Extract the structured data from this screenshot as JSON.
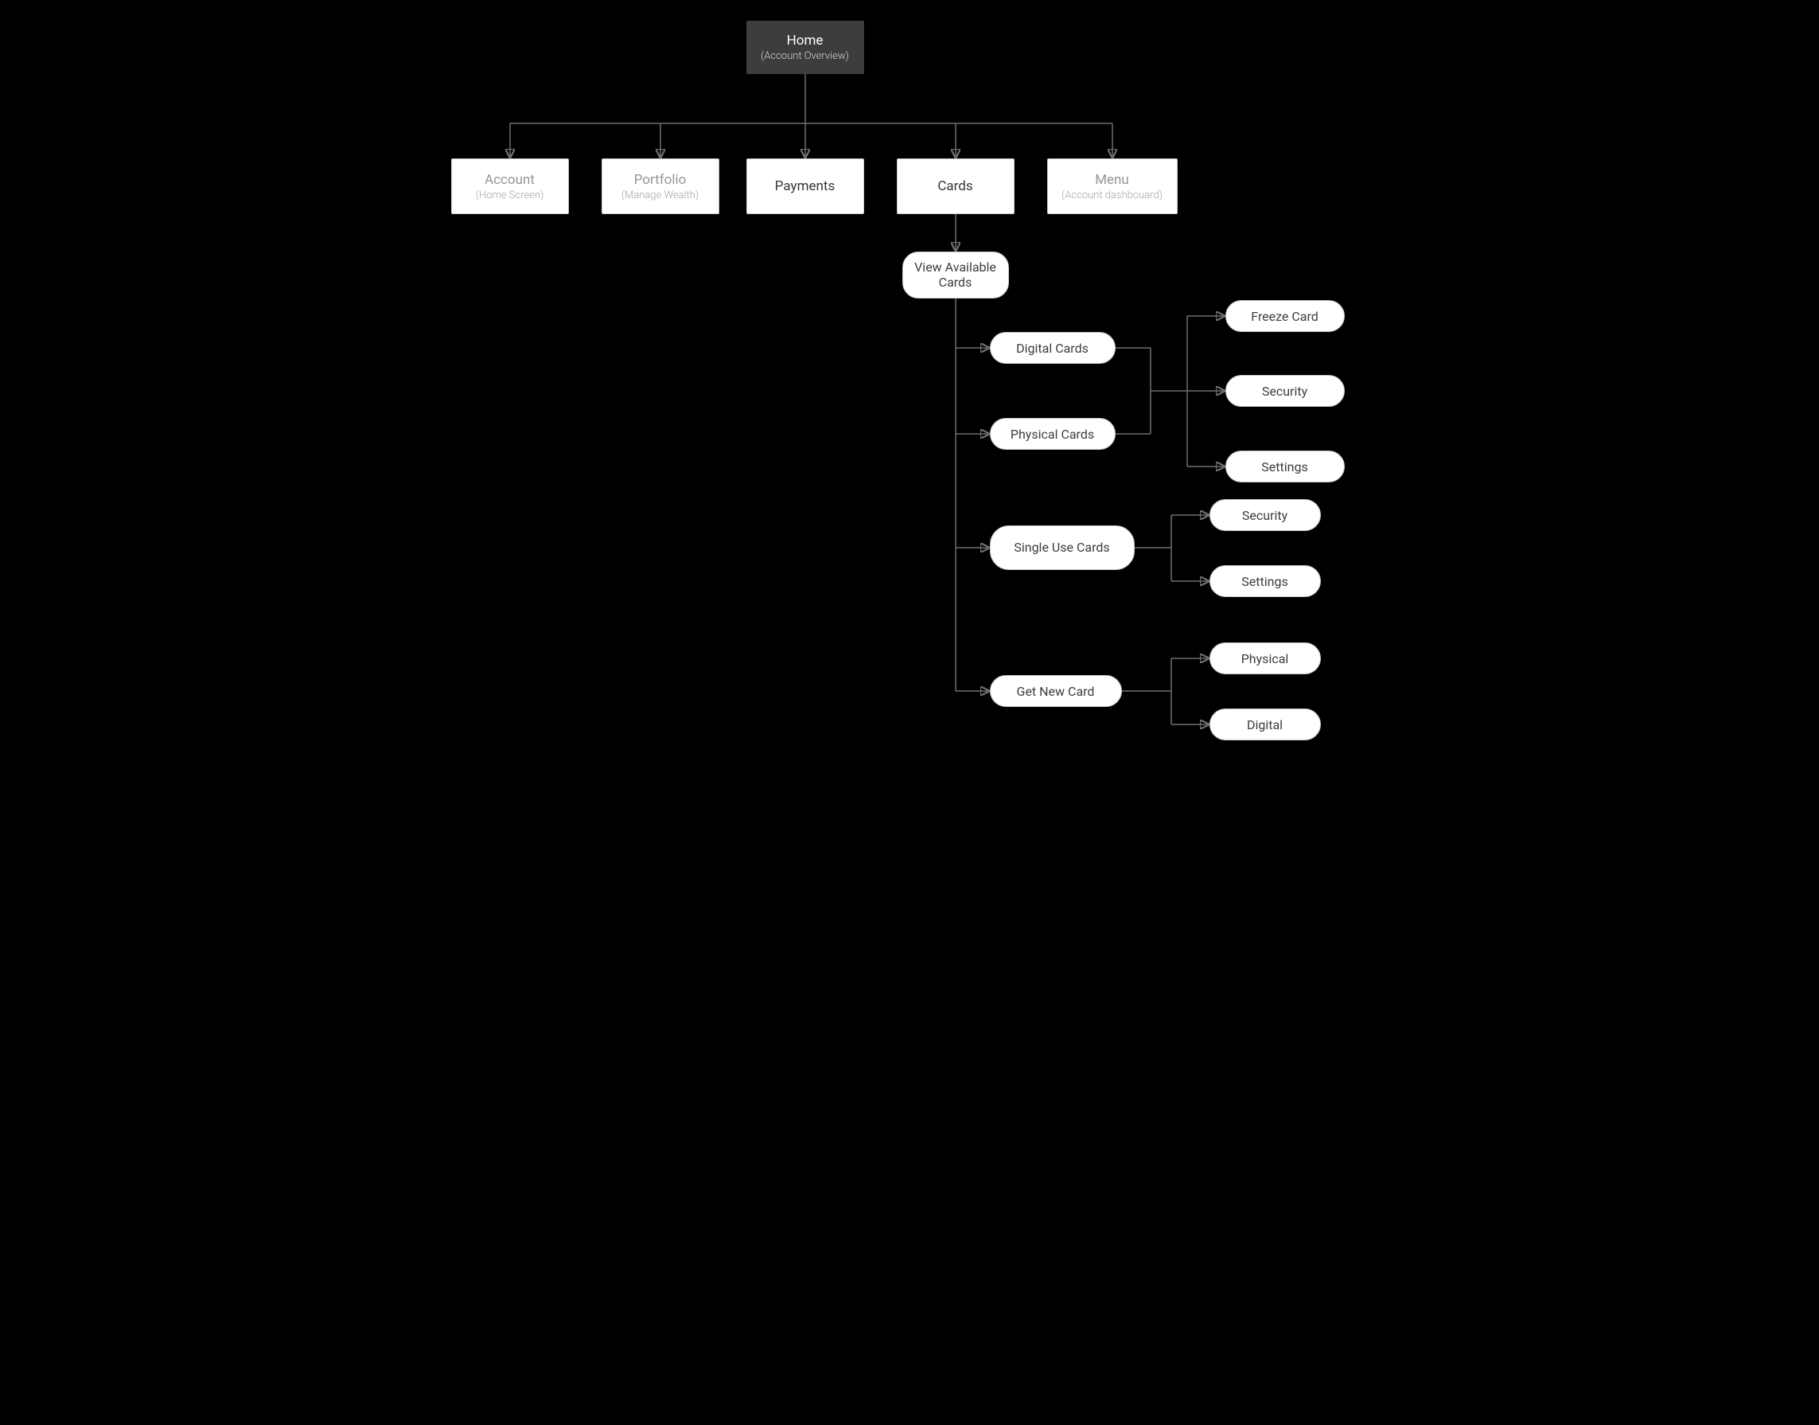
{
  "root": {
    "title": "Home",
    "sub": "(Account Overview)"
  },
  "level1": {
    "account": {
      "title": "Account",
      "sub": "(Home Screen)"
    },
    "portfolio": {
      "title": "Portfolio",
      "sub": "(Manage Wealth)"
    },
    "payments": {
      "title": "Payments"
    },
    "cards": {
      "title": "Cards"
    },
    "menu": {
      "title": "Menu",
      "sub": "(Account dashbouard)"
    }
  },
  "cards_children": {
    "view_available": "View Available Cards",
    "digital_cards": "Digital Cards",
    "physical_cards": "Physical Cards",
    "single_use": "Single Use Cards",
    "get_new": "Get New Card",
    "dp_freeze": "Freeze Card",
    "dp_security": "Security",
    "dp_settings": "Settings",
    "su_security": "Security",
    "su_settings": "Settings",
    "gn_physical": "Physical",
    "gn_digital": "Digital"
  }
}
